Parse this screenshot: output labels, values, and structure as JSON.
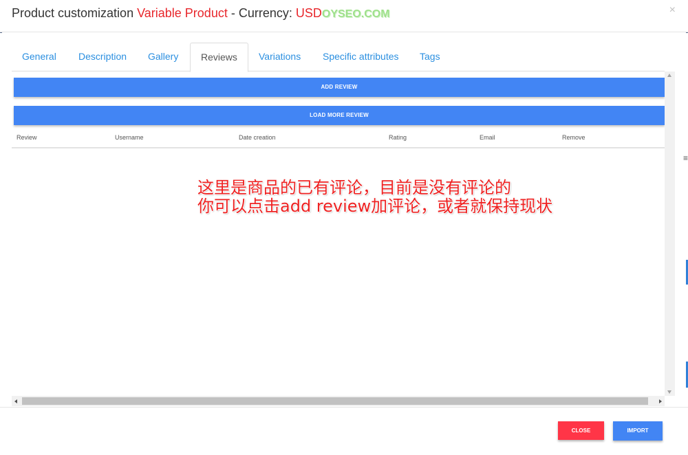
{
  "header": {
    "title_prefix": "Product customization ",
    "title_product_type": "Variable Product",
    "title_mid": " - Currency: ",
    "currency": "USD",
    "watermark": "OYSEO.COM",
    "close_symbol": "×"
  },
  "tabs": [
    {
      "label": "General",
      "active": false
    },
    {
      "label": "Description",
      "active": false
    },
    {
      "label": "Gallery",
      "active": false
    },
    {
      "label": "Reviews",
      "active": true
    },
    {
      "label": "Variations",
      "active": false
    },
    {
      "label": "Specific attributes",
      "active": false
    },
    {
      "label": "Tags",
      "active": false
    }
  ],
  "reviews": {
    "add_button": "ADD REVIEW",
    "load_more_button": "LOAD MORE REVIEW",
    "columns": [
      "Review",
      "Username",
      "Date creation",
      "Rating",
      "Email",
      "Remove"
    ],
    "rows": []
  },
  "annotation": {
    "line1": "这里是商品的已有评论，目前是没有评论的",
    "line2": "你可以点击add review加评论，或者就保持现状"
  },
  "footer": {
    "close_label": "CLOSE",
    "import_label": "IMPORT"
  },
  "colors": {
    "accent_blue": "#4285f4",
    "tab_blue": "#2b8fe0",
    "danger_red": "#ff3547",
    "title_red": "#e8262b",
    "annotation_red": "#ee2222"
  }
}
